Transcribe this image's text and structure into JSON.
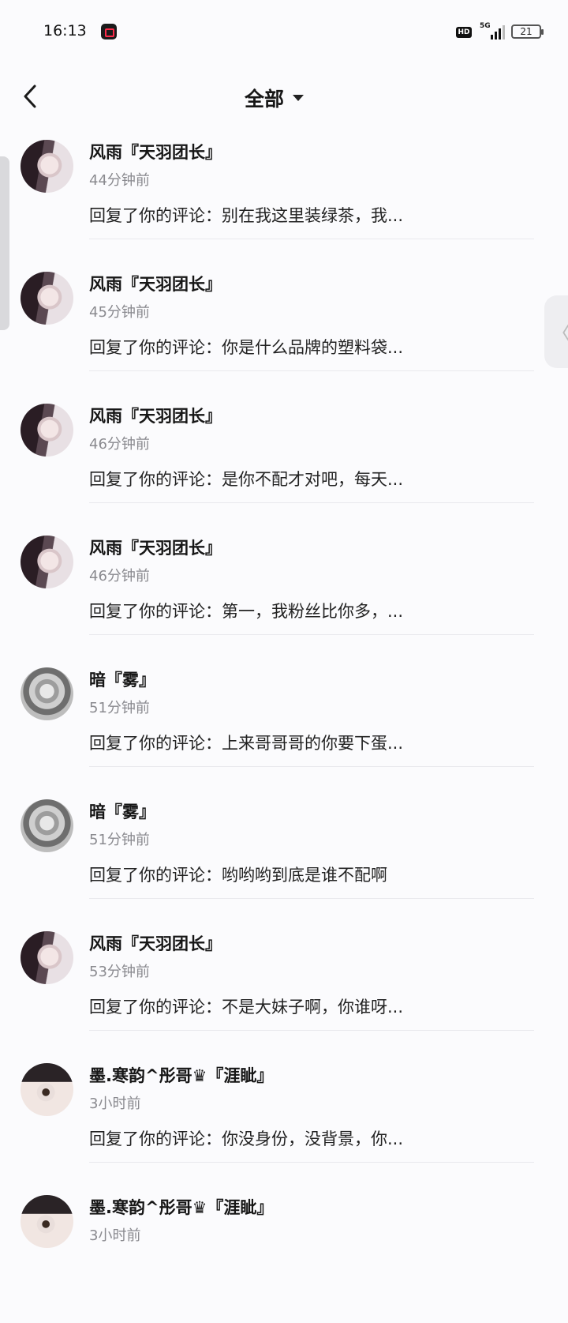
{
  "status_bar": {
    "time": "16:13",
    "hd": "HD",
    "network": "5G",
    "battery": "21"
  },
  "header": {
    "title": "全部"
  },
  "colors": {
    "background": "#fbfbfd",
    "secondary_text": "#8a8a8f",
    "divider": "#e9e9ed"
  },
  "notifications": [
    {
      "name": "风雨『天羽团长』",
      "time": "44分钟前",
      "message": "回复了你的评论：别在我这里装绿茶，我...",
      "avatar": "av-a"
    },
    {
      "name": "风雨『天羽团长』",
      "time": "45分钟前",
      "message": "回复了你的评论：你是什么品牌的塑料袋...",
      "avatar": "av-a"
    },
    {
      "name": "风雨『天羽团长』",
      "time": "46分钟前",
      "message": "回复了你的评论：是你不配才对吧，每天...",
      "avatar": "av-a"
    },
    {
      "name": "风雨『天羽团长』",
      "time": "46分钟前",
      "message": "回复了你的评论：第一，我粉丝比你多，...",
      "avatar": "av-a"
    },
    {
      "name": "暗『雾』",
      "time": "51分钟前",
      "message": "回复了你的评论：上来哥哥哥的你要下蛋...",
      "avatar": "av-b"
    },
    {
      "name": "暗『雾』",
      "time": "51分钟前",
      "message": "回复了你的评论：哟哟哟到底是谁不配啊",
      "avatar": "av-b"
    },
    {
      "name": "风雨『天羽团长』",
      "time": "53分钟前",
      "message": "回复了你的评论：不是大妹子啊，你谁呀...",
      "avatar": "av-a"
    },
    {
      "name": "墨.寒韵^彤哥♛『涯眦』",
      "time": "3小时前",
      "message": "回复了你的评论：你没身份，没背景，你...",
      "avatar": "av-c"
    },
    {
      "name": "墨.寒韵^彤哥♛『涯眦』",
      "time": "3小时前",
      "message": "",
      "avatar": "av-c"
    }
  ]
}
